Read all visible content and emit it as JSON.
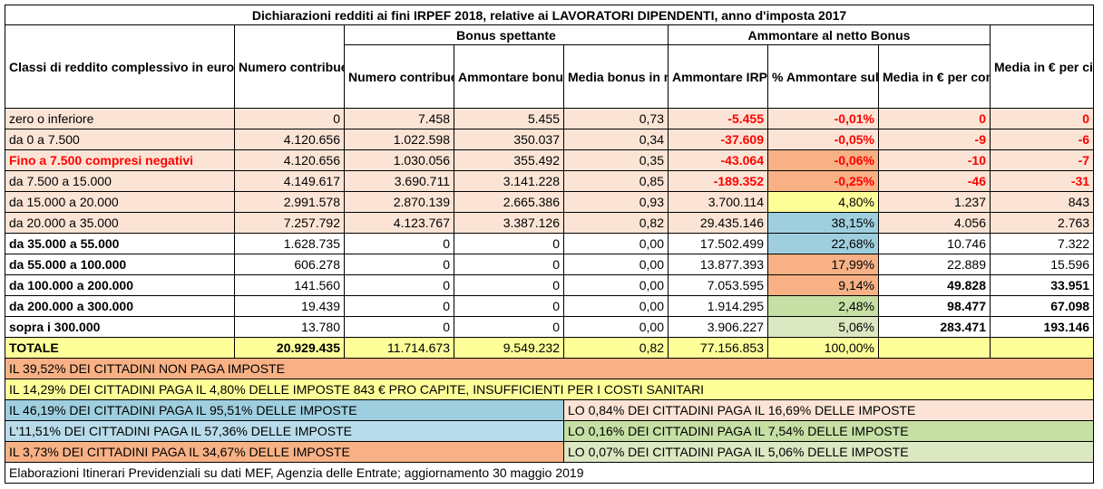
{
  "title": "Dichiarazioni redditi ai fini IRPEF 2018, relative ai LAVORATORI DIPENDENTI, anno d'imposta 2017",
  "headers": {
    "classi": "Classi di reddito complessivo in euro",
    "numero_contribuenti": "Numero contribuenti",
    "bonus_group": "Bonus spettante",
    "netto_group": "Ammontare al netto Bonus",
    "bonus_numero": "Numero contribuenti",
    "bonus_ammontare": "Ammontare bonus in migliaia di €",
    "bonus_media": "Media bonus in migliaia di €",
    "ammontare_irpef": "Ammontare IRPEF in migliaia di €",
    "perc_ammontare": "% Ammontare sul totale",
    "media_contribuente": "Media in € per contribuente",
    "media_cittadino": "Media in € per cittadino"
  },
  "rows": [
    {
      "label": "zero o inferiore",
      "n": "0",
      "bn": "7.458",
      "ba": "5.455",
      "bm": "0,73",
      "irpef": "-5.455",
      "perc": "-0,01%",
      "mc": "0",
      "mcit": "0"
    },
    {
      "label": "da 0 a 7.500",
      "n": "4.120.656",
      "bn": "1.022.598",
      "ba": "350.037",
      "bm": "0,34",
      "irpef": "-37.609",
      "perc": "-0,05%",
      "mc": "-9",
      "mcit": "-6"
    },
    {
      "label": "Fino a 7.500 compresi negativi",
      "n": "4.120.656",
      "bn": "1.030.056",
      "ba": "355.492",
      "bm": "0,35",
      "irpef": "-43.064",
      "perc": "-0,06%",
      "mc": "-10",
      "mcit": "-7"
    },
    {
      "label": "da 7.500 a 15.000",
      "n": "4.149.617",
      "bn": "3.690.711",
      "ba": "3.141.228",
      "bm": "0,85",
      "irpef": "-189.352",
      "perc": "-0,25%",
      "mc": "-46",
      "mcit": "-31"
    },
    {
      "label": "da 15.000 a 20.000",
      "n": "2.991.578",
      "bn": "2.870.139",
      "ba": "2.665.386",
      "bm": "0,93",
      "irpef": "3.700.114",
      "perc": "4,80%",
      "mc": "1.237",
      "mcit": "843"
    },
    {
      "label": "da 20.000 a 35.000",
      "n": "7.257.792",
      "bn": "4.123.767",
      "ba": "3.387.126",
      "bm": "0,82",
      "irpef": "29.435.146",
      "perc": "38,15%",
      "mc": "4.056",
      "mcit": "2.763"
    },
    {
      "label": "da 35.000 a 55.000",
      "n": "1.628.735",
      "bn": "0",
      "ba": "0",
      "bm": "0,00",
      "irpef": "17.502.499",
      "perc": "22,68%",
      "mc": "10.746",
      "mcit": "7.322"
    },
    {
      "label": "da 55.000 a 100.000",
      "n": "606.278",
      "bn": "0",
      "ba": "0",
      "bm": "0,00",
      "irpef": "13.877.393",
      "perc": "17,99%",
      "mc": "22.889",
      "mcit": "15.596"
    },
    {
      "label": "da 100.000 a 200.000",
      "n": "141.560",
      "bn": "0",
      "ba": "0",
      "bm": "0,00",
      "irpef": "7.053.595",
      "perc": "9,14%",
      "mc": "49.828",
      "mcit": "33.951"
    },
    {
      "label": "da 200.000 a 300.000",
      "n": "19.439",
      "bn": "0",
      "ba": "0",
      "bm": "0,00",
      "irpef": "1.914.295",
      "perc": "2,48%",
      "mc": "98.477",
      "mcit": "67.098"
    },
    {
      "label": "sopra i 300.000",
      "n": "13.780",
      "bn": "0",
      "ba": "0",
      "bm": "0,00",
      "irpef": "3.906.227",
      "perc": "5,06%",
      "mc": "283.471",
      "mcit": "193.146"
    }
  ],
  "totale": {
    "label": "TOTALE",
    "n": "20.929.435",
    "bn": "11.714.673",
    "ba": "9.549.232",
    "bm": "0,82",
    "irpef": "77.156.853",
    "perc": "100,00%"
  },
  "notes": {
    "line1": "IL 39,52% DEI CITTADINI NON PAGA  IMPOSTE",
    "line2": "IL 14,29% DEI CITTADINI PAGA IL 4,80% DELLE IMPOSTE 843 € PRO CAPITE, INSUFFICIENTI PER I COSTI SANITARI",
    "l3a": "IL 46,19% DEI CITTADINI PAGA IL 95,51% DELLE IMPOSTE",
    "l3b": "LO 0,84% DEI CITTADINI PAGA IL 16,69% DELLE IMPOSTE",
    "l4a": "L'11,51% DEI CITTADINI PAGA IL 57,36% DELLE IMPOSTE",
    "l4b": "LO 0,16% DEI CITTADINI PAGA IL 7,54% DELLE IMPOSTE",
    "l5a": "IL 3,73% DEI CITTADINI PAGA IL 34,67% DELLE IMPOSTE",
    "l5b": "LO 0,07% DEI CITTADINI PAGA IL 5,06% DELLE IMPOSTE",
    "source": "Elaborazioni Itinerari Previdenziali su dati MEF, Agenzia delle Entrate; aggiornamento 30 maggio 2019"
  },
  "colors": {
    "pink": "#fbe4d5",
    "yellow": "#ffff99",
    "blue": "#9fcfdf",
    "orange": "#f7b185",
    "green": "#c5dfa4",
    "light_green": "#dbe8c2",
    "light_blue": "#b8dcea",
    "negative": "#ff0000"
  }
}
